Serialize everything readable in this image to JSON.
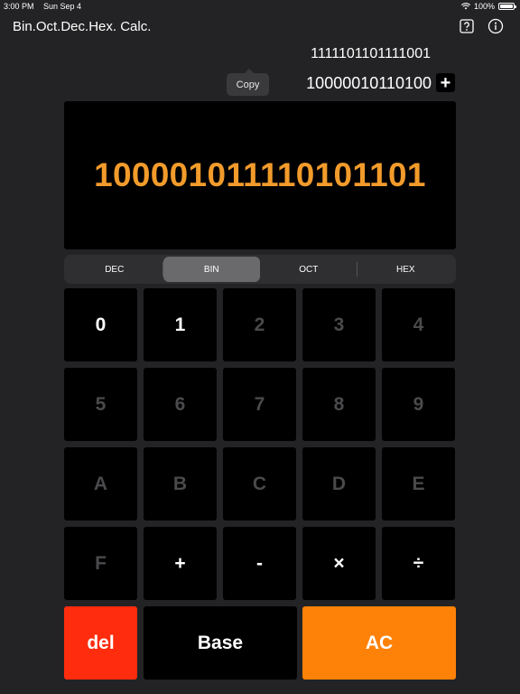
{
  "status": {
    "time": "3:00 PM",
    "date": "Sun Sep 4",
    "battery": "100%"
  },
  "app": {
    "title": "Bin.Oct.Dec.Hex. Calc."
  },
  "icons": {
    "help": "question-box-icon",
    "info": "info-circle-icon",
    "add": "plus-icon",
    "wifi": "wifi-icon",
    "battery": "battery-icon"
  },
  "history": {
    "line1": "1111101101111001",
    "line2": "10000010110100",
    "add_label": "+"
  },
  "tooltip": {
    "copy": "Copy"
  },
  "display": {
    "value": "100001011110101101"
  },
  "tabs": [
    {
      "label": "DEC"
    },
    {
      "label": "BIN"
    },
    {
      "label": "OCT"
    },
    {
      "label": "HEX"
    }
  ],
  "selected_tab": "BIN",
  "keys": {
    "k0": "0",
    "k1": "1",
    "k2": "2",
    "k3": "3",
    "k4": "4",
    "k5": "5",
    "k6": "6",
    "k7": "7",
    "k8": "8",
    "k9": "9",
    "kA": "A",
    "kB": "B",
    "kC": "C",
    "kD": "D",
    "kE": "E",
    "kF": "F",
    "plus": "+",
    "minus": "-",
    "times": "×",
    "divide": "÷",
    "del": "del",
    "base": "Base",
    "ac": "AC"
  },
  "colors": {
    "accent_orange": "#f29b2b",
    "del_red": "#ff2c0d",
    "ac_orange": "#ff8208",
    "background": "#232325"
  }
}
